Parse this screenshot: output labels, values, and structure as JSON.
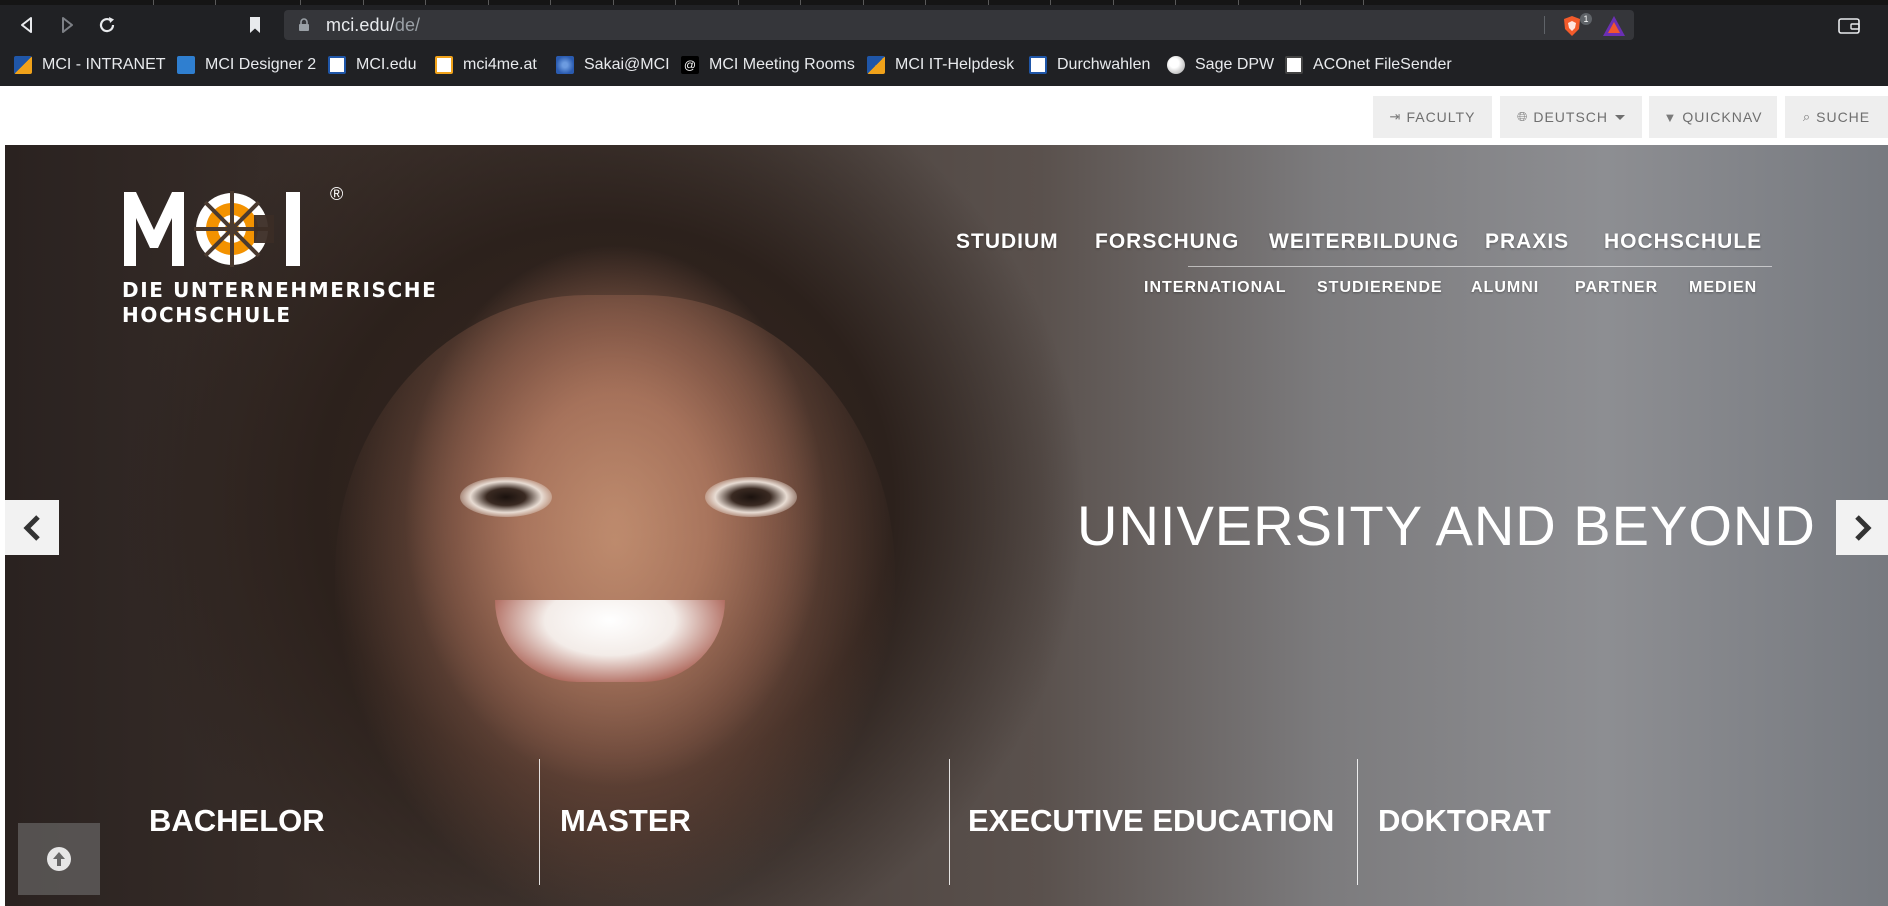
{
  "browser": {
    "url_host": "mci.edu/",
    "url_path": "de/",
    "shield_count": "1",
    "icons": [
      "back-icon",
      "forward-icon",
      "reload-icon",
      "bookmark-icon",
      "lock-icon",
      "brave-shield-icon",
      "brave-rewards-icon",
      "wallet-icon"
    ]
  },
  "bookmarks": [
    {
      "label": "MCI - INTRANET",
      "icon": "mci-favicon",
      "color": "#f0a21a"
    },
    {
      "label": "MCI Designer 2",
      "icon": "designer-favicon",
      "color": "#2f7fd0"
    },
    {
      "label": "MCI.edu",
      "icon": "mci-edu-favicon",
      "color": "#1f56a8"
    },
    {
      "label": "mci4me.at",
      "icon": "mci4me-favicon",
      "color": "#1f56a8"
    },
    {
      "label": "Sakai@MCI",
      "icon": "sakai-favicon",
      "color": "#2a5bb0"
    },
    {
      "label": "MCI Meeting Rooms",
      "icon": "at-sign-favicon",
      "color": "#000000"
    },
    {
      "label": "MCI IT-Helpdesk",
      "icon": "mci-favicon",
      "color": "#f0a21a"
    },
    {
      "label": "Durchwahlen",
      "icon": "durchwahlen-favicon",
      "color": "#1f56a8"
    },
    {
      "label": "Sage DPW",
      "icon": "globe-favicon",
      "color": "#ffffff"
    },
    {
      "label": "ACOnet FileSender",
      "icon": "filesender-favicon",
      "color": "#ffffff"
    }
  ],
  "topbar": {
    "faculty": "FACULTY",
    "language": "DEUTSCH",
    "quicknav": "QUICKNAV",
    "search": "SUCHE"
  },
  "logo": {
    "letters": "MCI",
    "registered": "®",
    "tagline_line1": "DIE UNTERNEHMERISCHE",
    "tagline_line2": "HOCHSCHULE",
    "accent_color": "#f39200"
  },
  "nav": {
    "main": [
      "STUDIUM",
      "FORSCHUNG",
      "WEITERBILDUNG",
      "PRAXIS",
      "HOCHSCHULE"
    ],
    "sub": [
      "INTERNATIONAL",
      "STUDIERENDE",
      "ALUMNI",
      "PARTNER",
      "MEDIEN"
    ]
  },
  "hero": {
    "headline": "UNIVERSITY AND BEYOND",
    "categories": [
      "BACHELOR",
      "MASTER",
      "EXECUTIVE EDUCATION",
      "DOKTORAT"
    ]
  }
}
